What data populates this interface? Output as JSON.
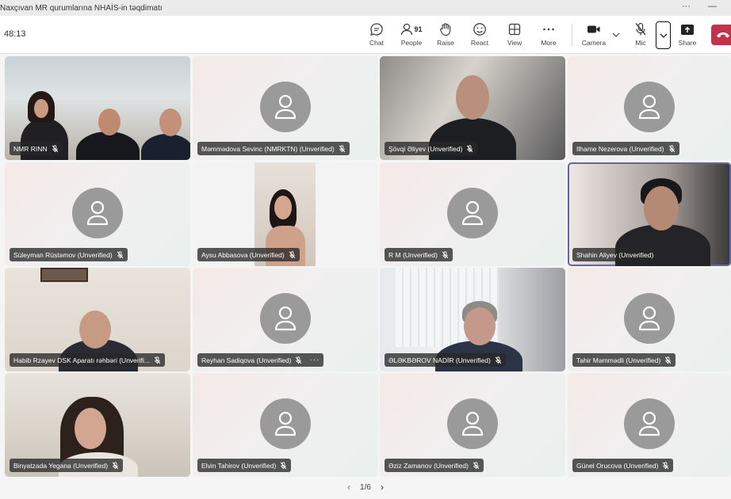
{
  "window": {
    "title": "Naxçıvan MR qurumlarına NHAİS-in təqdimatı",
    "more": "···",
    "minimize": "—"
  },
  "toolbar": {
    "timer": "48:13",
    "chat": "Chat",
    "people": "People",
    "people_count": "91",
    "raise": "Raise",
    "react": "React",
    "view": "View",
    "more": "More",
    "camera": "Camera",
    "mic": "Mic",
    "share": "Share"
  },
  "participants": [
    {
      "name": "NMR RINN",
      "video": true
    },
    {
      "name": "Məmmədova Sevinc (NMRKTN) (Unverified)",
      "video": false
    },
    {
      "name": "Şövqi Əliyev (Unverified)",
      "video": true
    },
    {
      "name": "Ilhame Nezerova (Unverified)",
      "video": false
    },
    {
      "name": "Süleyman Rüstəmov (Unverified)",
      "video": false
    },
    {
      "name": "Aysu Abbasova (Unverified)",
      "video": true
    },
    {
      "name": "R M (Unverified)",
      "video": false
    },
    {
      "name": "Shahin Aliyev (Unverified)",
      "video": true,
      "speaking": true
    },
    {
      "name": "Habib Rzayev DSK Aparatı rəhbəri (Unverifi...",
      "video": true
    },
    {
      "name": "Reyhan Sadiqova (Unverified)",
      "video": false,
      "more": "···"
    },
    {
      "name": "ƏLƏKBƏROV NADİR (Unverified)",
      "video": true
    },
    {
      "name": "Tahir Məmmədli (Unverified)",
      "video": false
    },
    {
      "name": "Binyatzada Yegana (Unverified)",
      "video": true
    },
    {
      "name": "Elvin Tahirov (Unverified)",
      "video": false
    },
    {
      "name": "Əziz Zamanov (Unverified)",
      "video": false
    },
    {
      "name": "Günel Orucova (Unverified)",
      "video": false
    }
  ],
  "pager": {
    "label": "1/6",
    "prev": "‹",
    "next": "›"
  },
  "colors": {
    "leave": "#c4314b",
    "speaking_outline": "#6264a7",
    "avatar": "#9a9a9a"
  }
}
